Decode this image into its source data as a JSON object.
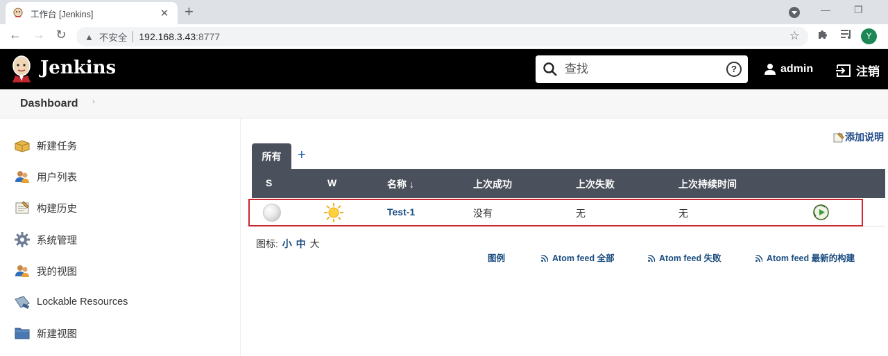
{
  "browser": {
    "tab_title": "工作台 [Jenkins]",
    "insecure_label": "不安全",
    "url_host": "192.168.3.43",
    "url_port": ":8777",
    "profile_initial": "Y"
  },
  "header": {
    "app_name": "Jenkins",
    "search_placeholder": "查找",
    "help": "?",
    "user": "admin",
    "logout": "注销"
  },
  "breadcrumb": {
    "dashboard": "Dashboard"
  },
  "sidebar": {
    "items": [
      {
        "label": "新建任务",
        "icon": "new-package-icon"
      },
      {
        "label": "用户列表",
        "icon": "users-icon"
      },
      {
        "label": "构建历史",
        "icon": "notepad-icon"
      },
      {
        "label": "系统管理",
        "icon": "gear-icon"
      },
      {
        "label": "我的视图",
        "icon": "user-view-icon"
      },
      {
        "label": "Lockable Resources",
        "icon": "lock-resource-icon"
      },
      {
        "label": "新建视图",
        "icon": "folder-icon"
      }
    ]
  },
  "main": {
    "add_description": "添加说明",
    "tabs": [
      {
        "label": "所有"
      }
    ],
    "add_tab": "+",
    "table": {
      "headers": [
        "S",
        "W",
        "名称 ↓",
        "上次成功",
        "上次失败",
        "上次持续时间"
      ],
      "rows": [
        {
          "status": "not-built",
          "weather": "sunny",
          "name": "Test-1",
          "last_success": "没有",
          "last_failure": "无",
          "last_duration": "无"
        }
      ]
    },
    "icon_size": {
      "label": "图标:",
      "small": "小",
      "medium": "中",
      "large": "大"
    },
    "footer_links": {
      "legend": "图例",
      "atom_all": "Atom feed 全部",
      "atom_failures": "Atom feed 失败",
      "atom_latest": "Atom feed 最新的构建"
    }
  },
  "colors": {
    "header_bg": "#000000",
    "table_header_bg": "#4b515c",
    "link": "#1a4c80",
    "highlight_border": "#c8282e"
  }
}
